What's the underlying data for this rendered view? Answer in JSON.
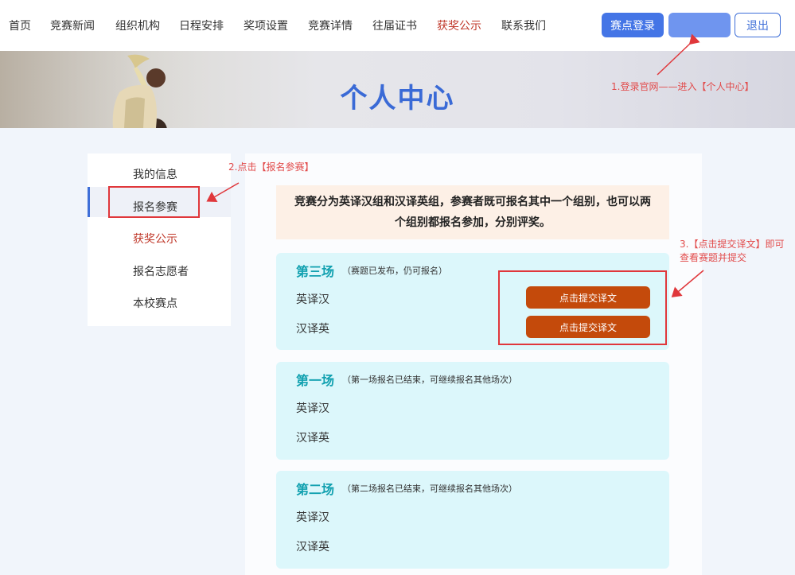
{
  "nav": {
    "items": [
      "首页",
      "竞赛新闻",
      "组织机构",
      "日程安排",
      "奖项设置",
      "竞赛详情",
      "往届证书",
      "获奖公示",
      "联系我们"
    ],
    "active_index": 7,
    "login_label": "赛点登录",
    "logout_label": "退出"
  },
  "banner": {
    "title": "个人中心"
  },
  "sidebar": {
    "items": [
      "我的信息",
      "报名参赛",
      "获奖公示",
      "报名志愿者",
      "本校赛点"
    ],
    "active_index": 1
  },
  "notice": {
    "text": "竞赛分为英译汉组和汉译英组，参赛者既可报名其中一个组别，也可以两个组别都报名参加，分别评奖。"
  },
  "sessions": [
    {
      "title": "第三场",
      "note": "（赛题已发布，仍可报名）",
      "rows": [
        "英译汉",
        "汉译英"
      ],
      "submit_label": "点击提交译文"
    },
    {
      "title": "第一场",
      "note": "（第一场报名已结束，可继续报名其他场次）",
      "rows": [
        "英译汉",
        "汉译英"
      ]
    },
    {
      "title": "第二场",
      "note": "（第二场报名已结束，可继续报名其他场次）",
      "rows": [
        "英译汉",
        "汉译英"
      ]
    }
  ],
  "annotations": {
    "step1": "1.登录官网——进入【个人中心】",
    "step2": "2.点击【报名参赛】",
    "step3_line1": "3.【点击提交译文】即可",
    "step3_line2": "查看赛题并提交"
  },
  "colors": {
    "accent_blue": "#3f6fd8",
    "active_red": "#c0392b",
    "submit_orange": "#c44a0b",
    "session_teal": "#12a1b0",
    "annotation_red": "#e0373b"
  }
}
